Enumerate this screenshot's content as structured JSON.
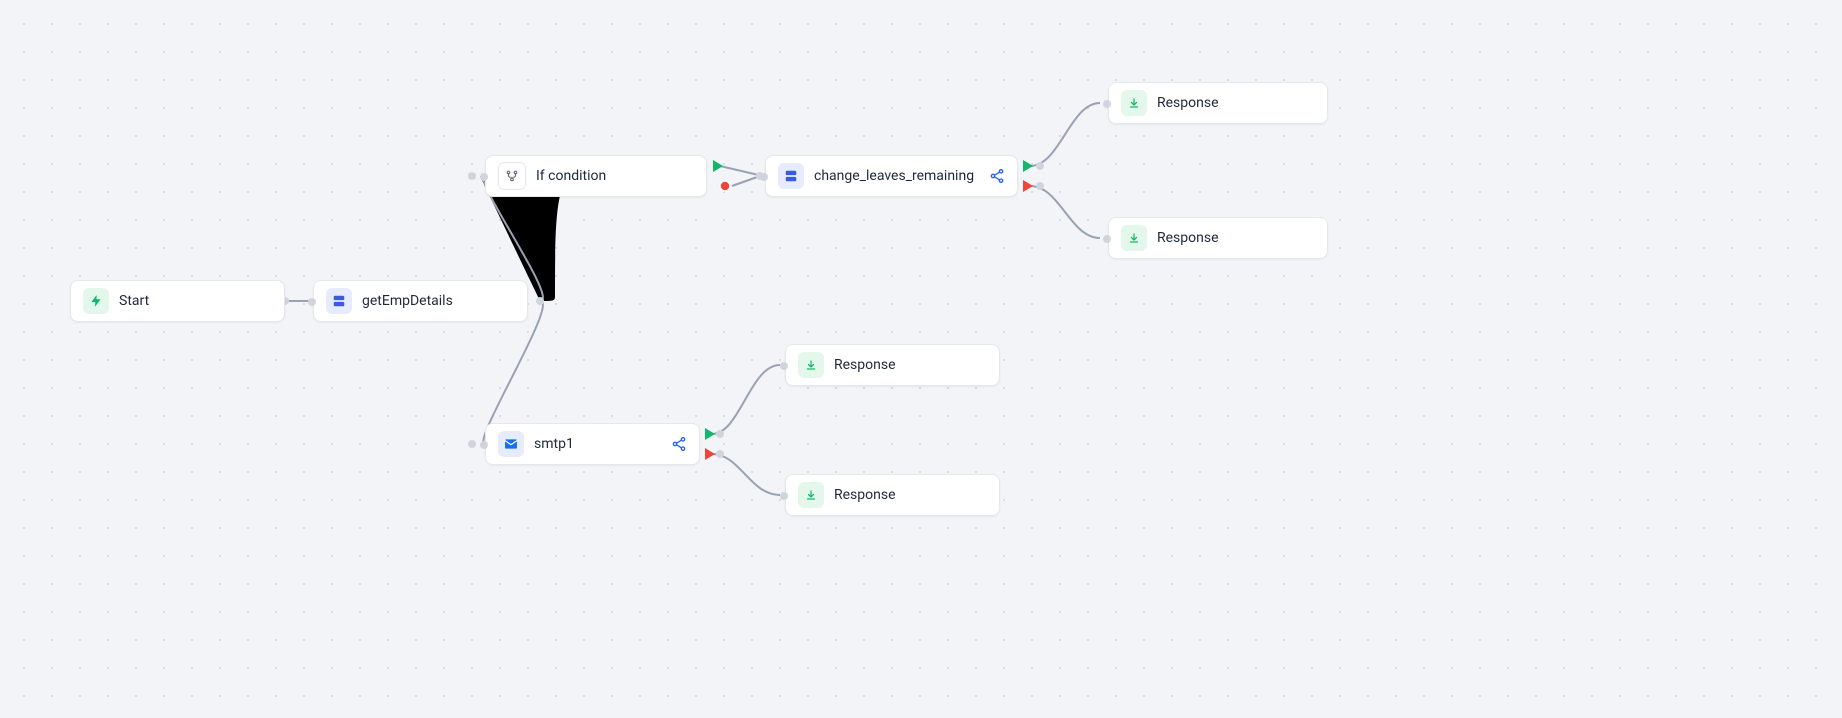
{
  "nodes": {
    "start": {
      "label": "Start"
    },
    "getEmpDetails": {
      "label": "getEmpDetails"
    },
    "ifCondition": {
      "label": "If condition"
    },
    "smtp1": {
      "label": "smtp1"
    },
    "changeLeaves": {
      "label": "change_leaves_remaining"
    },
    "response1": {
      "label": "Response"
    },
    "response2": {
      "label": "Response"
    },
    "response3": {
      "label": "Response"
    },
    "response4": {
      "label": "Response"
    }
  }
}
